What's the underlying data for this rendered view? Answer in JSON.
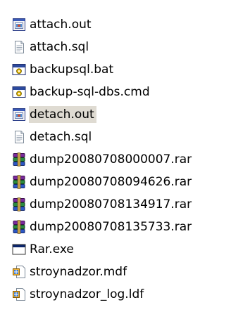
{
  "files": [
    {
      "name": "attach.out",
      "icon": "output-file-icon",
      "selected": false
    },
    {
      "name": "attach.sql",
      "icon": "sql-text-file-icon",
      "selected": false
    },
    {
      "name": "backupsql.bat",
      "icon": "batch-file-icon",
      "selected": false
    },
    {
      "name": "backup-sql-dbs.cmd",
      "icon": "batch-file-icon",
      "selected": false
    },
    {
      "name": "detach.out",
      "icon": "output-file-icon",
      "selected": true
    },
    {
      "name": "detach.sql",
      "icon": "sql-text-file-icon",
      "selected": false
    },
    {
      "name": "dump20080708000007.rar",
      "icon": "rar-archive-icon",
      "selected": false
    },
    {
      "name": "dump20080708094626.rar",
      "icon": "rar-archive-icon",
      "selected": false
    },
    {
      "name": "dump20080708134917.rar",
      "icon": "rar-archive-icon",
      "selected": false
    },
    {
      "name": "dump20080708135733.rar",
      "icon": "rar-archive-icon",
      "selected": false
    },
    {
      "name": "Rar.exe",
      "icon": "application-window-icon",
      "selected": false
    },
    {
      "name": "stroynadzor.mdf",
      "icon": "database-file-icon",
      "selected": false
    },
    {
      "name": "stroynadzor_log.ldf",
      "icon": "database-file-icon",
      "selected": false
    }
  ],
  "colors": {
    "selection": "#dfdbd2",
    "text": "#000000"
  }
}
